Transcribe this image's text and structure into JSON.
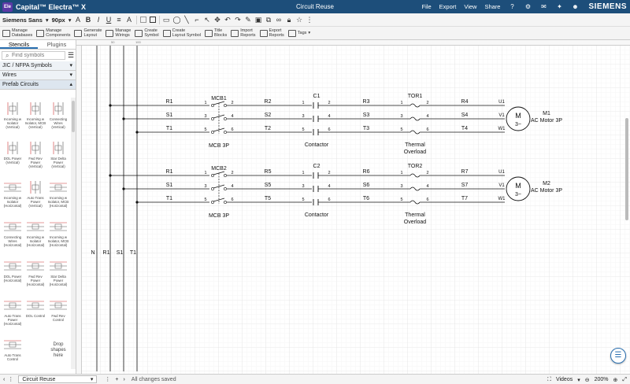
{
  "titlebar": {
    "app_logo": "Ele",
    "app_title": "Capital™ Electra™ X",
    "doc_title": "Circuit Reuse",
    "menu": [
      "File",
      "Export",
      "View",
      "Share"
    ],
    "brand": "SIEMENS"
  },
  "toolbar1": {
    "font_family": "Siemens Sans",
    "font_size": "90px"
  },
  "toolbar2": {
    "buttons": [
      "Manage\nDatabases",
      "Manage\nComponents",
      "Generate\nLayout",
      "Manage\nWirings",
      "Create\nSymbol",
      "Create\nLayout Symbol",
      "Title\nBlocks",
      "Import\nReports",
      "Export\nReports",
      "Tags"
    ]
  },
  "left_panel": {
    "tabs": [
      "Stencils",
      "Plugins"
    ],
    "search_placeholder": "Find symbols",
    "categories": [
      "JIC / NFPA Symbols",
      "Wires",
      "Prefab Circuits"
    ],
    "stencils": [
      "Incoming w Isolator (Vertical)",
      "Incoming w Isolator, MCB (Vertical)",
      "Connecting Wires (Vertical)",
      "DOL Power (Vertical)",
      "Fwd Rev Power (Vertical)",
      "Star Delta Power (Vertical)",
      "Incoming w Isolator (Horizontal)",
      "Auto Trans Power (Vertical)",
      "Incoming w Isolator, MCB (Horizontal)",
      "Connecting Wires (Horizontal)",
      "Incoming w Isolator (Horizontal)",
      "Incoming w Isolator, MCB (Horizontal)",
      "DOL Power (Horizontal)",
      "Fwd Rev Power (Horizontal)",
      "Star Delta Power (Horizontal)",
      "Auto Trans Power (Horizontal)",
      "DOL Control",
      "Fwd Rev Control",
      "Auto Trans Control",
      "",
      "Drop shapes here"
    ]
  },
  "ruler": [
    "50",
    "100"
  ],
  "schematic": {
    "bus_labels": [
      "N",
      "R1",
      "S1",
      "T1"
    ],
    "circuits": [
      {
        "phases_in": [
          "R1",
          "S1",
          "T1"
        ],
        "mcb": "MCB1",
        "mcb_type": "MCB 3P",
        "mid_wires": [
          "R2",
          "S2",
          "T2"
        ],
        "contactor": "C1",
        "contactor_type": "Contactor",
        "post_wires": [
          "R3",
          "S3",
          "T3"
        ],
        "overload": "TOR1",
        "overload_type": "Thermal\nOverload",
        "out_wires": [
          "R4",
          "S4",
          "T4"
        ],
        "terminals": [
          "U1",
          "V1",
          "W1"
        ],
        "pins": [
          "1",
          "2",
          "3",
          "4",
          "5",
          "6"
        ],
        "motor_tag": "M1",
        "motor_desc": "AC Motor 3P"
      },
      {
        "phases_in": [
          "R1",
          "S1",
          "T1"
        ],
        "mcb": "MCB2",
        "mcb_type": "MCB 3P",
        "mid_wires": [
          "R5",
          "S5",
          "T5"
        ],
        "contactor": "C2",
        "contactor_type": "Contactor",
        "post_wires": [
          "R6",
          "S6",
          "T6"
        ],
        "overload": "TOR2",
        "overload_type": "Thermal\nOverload",
        "out_wires": [
          "R7",
          "S7",
          "T7"
        ],
        "terminals": [
          "U1",
          "V1",
          "W1"
        ],
        "pins": [
          "1",
          "2",
          "3",
          "4",
          "5",
          "6"
        ],
        "motor_tag": "M2",
        "motor_desc": "AC Motor 3P"
      }
    ],
    "motor_symbol": "M",
    "motor_phases": "3~"
  },
  "bottombar": {
    "page_name": "Circuit Reuse",
    "status": "All changes saved",
    "videos": "Videos",
    "zoom": "200%"
  }
}
